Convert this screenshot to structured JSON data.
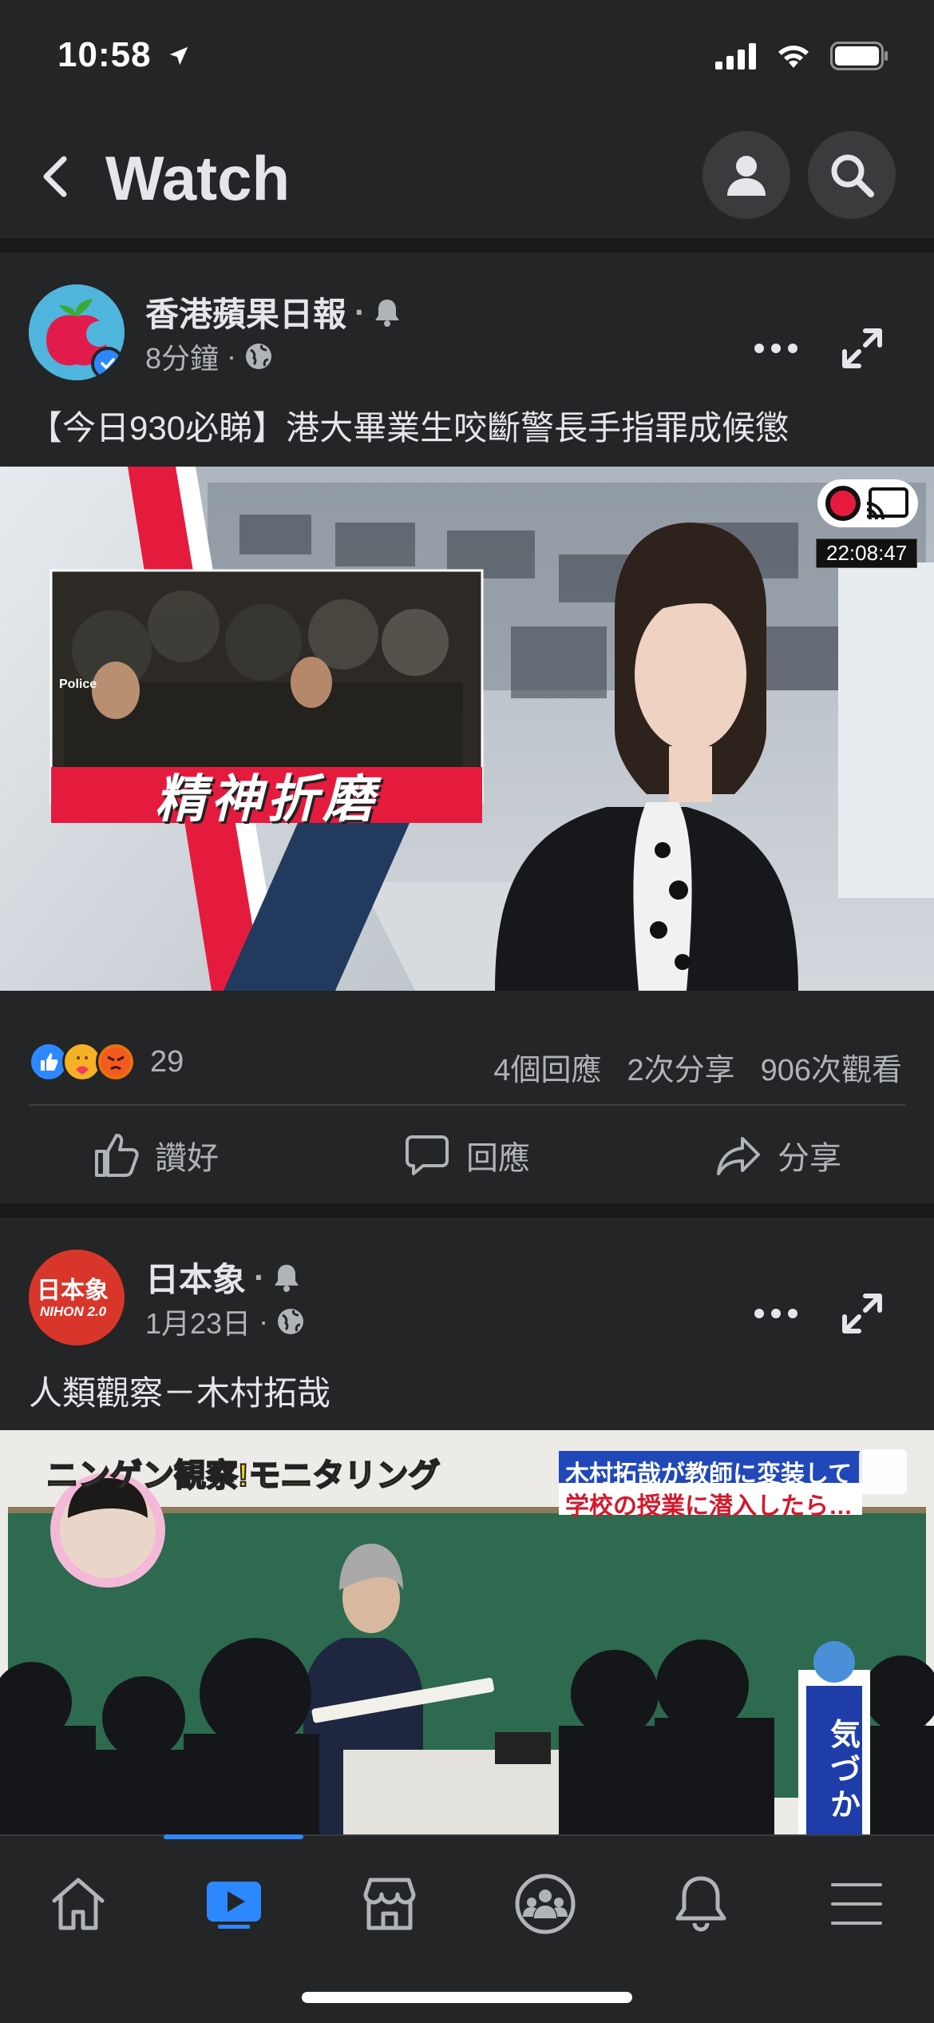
{
  "status": {
    "time": "10:58"
  },
  "header": {
    "title": "Watch"
  },
  "posts": [
    {
      "author": "香港蘋果日報",
      "time": "8分鐘",
      "caption": "【今日930必睇】港大畢業生咬斷警長手指罪成候懲",
      "video": {
        "overlay_text": "精神折磨",
        "duration": "22:08:47",
        "inset_badge": "Police"
      },
      "reaction_count": "29",
      "comments": "4個回應",
      "shares": "2次分享",
      "views": "906次觀看"
    },
    {
      "author": "日本象",
      "time": "1月23日",
      "caption": "人類觀察－木村拓哉",
      "avatar_text": "日本象",
      "avatar_sub": "NIHON 2.0",
      "video": {
        "banner_left": "ニンゲン観察!モニタリング",
        "banner_right_1": "木村拓哉が教師に変装して",
        "banner_right_2": "学校の授業に潜入したら…",
        "sign_text": "気づか"
      }
    }
  ],
  "actions": {
    "like": "讚好",
    "comment": "回應",
    "share": "分享"
  },
  "colors": {
    "accent": "#2d88ff",
    "bg": "#242526",
    "divider": "#18191a"
  },
  "nav": [
    "home-icon",
    "watch-icon",
    "marketplace-icon",
    "groups-icon",
    "notifications-icon",
    "menu-icon"
  ]
}
